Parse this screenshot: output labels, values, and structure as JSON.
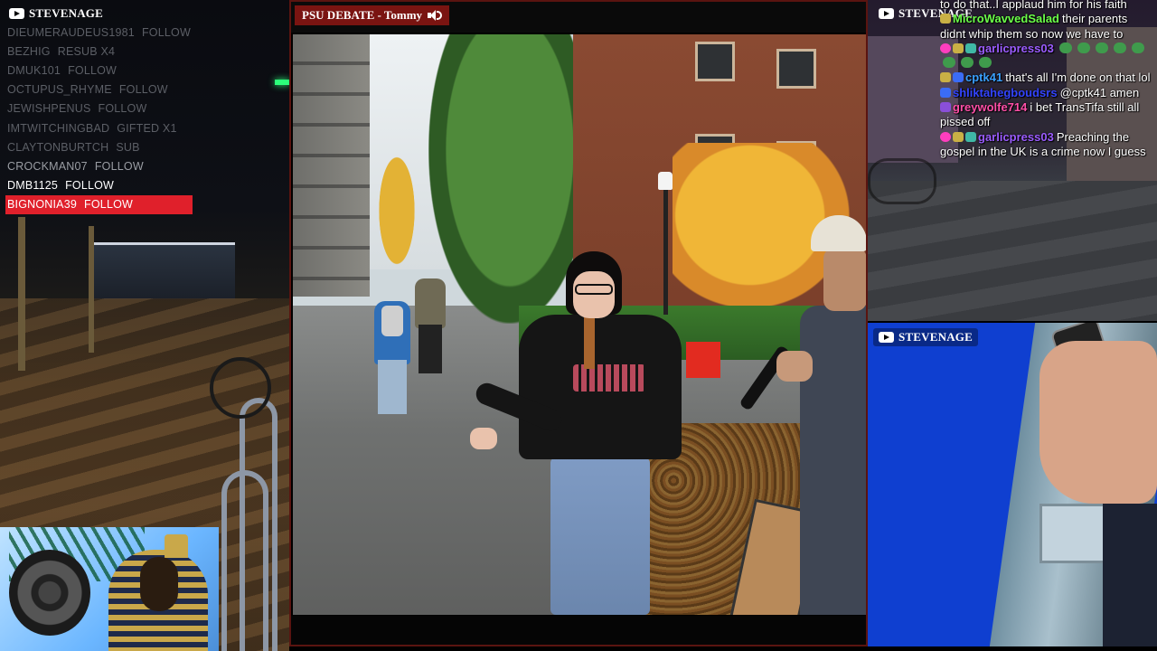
{
  "left_panel": {
    "channel": "STEVENAGE",
    "events": [
      {
        "name": "DIEUMERAUDEUS1981",
        "action": "FOLLOW",
        "style": "fade1"
      },
      {
        "name": "BEZHIG",
        "action": "RESUB X4",
        "style": "fade1"
      },
      {
        "name": "DMUK101",
        "action": "FOLLOW",
        "style": "fade1"
      },
      {
        "name": "OCTUPUS_RHYME",
        "action": "FOLLOW",
        "style": "fade1"
      },
      {
        "name": "JEWISHPENUS",
        "action": "FOLLOW",
        "style": "fade1"
      },
      {
        "name": "IMTWITCHINGBAD",
        "action": "GIFTED X1",
        "style": "fade1"
      },
      {
        "name": "CLAYTONBURTCH",
        "action": "SUB",
        "style": "fade1"
      },
      {
        "name": "CROCKMAN07",
        "action": "FOLLOW",
        "style": "fade2"
      },
      {
        "name": "DMB1125",
        "action": "FOLLOW",
        "style": "bright"
      },
      {
        "name": "BIGNONIA39",
        "action": "FOLLOW",
        "style": "highlight"
      }
    ]
  },
  "center_panel": {
    "title": "PSU DEBATE - Tommy",
    "sound_icon": "speaker-icon"
  },
  "right_top_panel": {
    "channel": "STEVENAGE",
    "chat": [
      {
        "user": "",
        "text": "to do that..I applaud him for his faith",
        "badges": [],
        "user_color": "#ffffff"
      },
      {
        "user": "MicroWavvedSalad",
        "text": "their parents didnt whip them so now we have to",
        "badges": [
          "gold"
        ],
        "user_color": "#6cff4a"
      },
      {
        "user": "garlicpress03",
        "text": "",
        "badges": [
          "heart",
          "gold",
          "teal"
        ],
        "user_color": "#9b5cff",
        "emotes": 8
      },
      {
        "user": "cptk41",
        "text": "that's all I'm done on that lol",
        "badges": [
          "gold",
          "blue"
        ],
        "user_color": "#3aa0ff"
      },
      {
        "user": "shliktahegboudsrs",
        "text": "@cptk41 amen",
        "badges": [
          "blue"
        ],
        "user_color": "#3344ff"
      },
      {
        "user": "greywolfe714",
        "text": "i bet TransTifa still all pissed off",
        "badges": [
          "purple"
        ],
        "user_color": "#ff4fa8"
      },
      {
        "user": "garlicpress03",
        "text": "Preaching the gospel in the UK is a crime now I guess",
        "badges": [
          "heart",
          "gold",
          "teal"
        ],
        "user_color": "#9b5cff"
      }
    ]
  },
  "right_bottom_panel": {
    "channel": "STEVENAGE"
  },
  "colors": {
    "highlight": "#e0202b",
    "title_bg": "#7a1411",
    "center_border": "#5a1410"
  }
}
